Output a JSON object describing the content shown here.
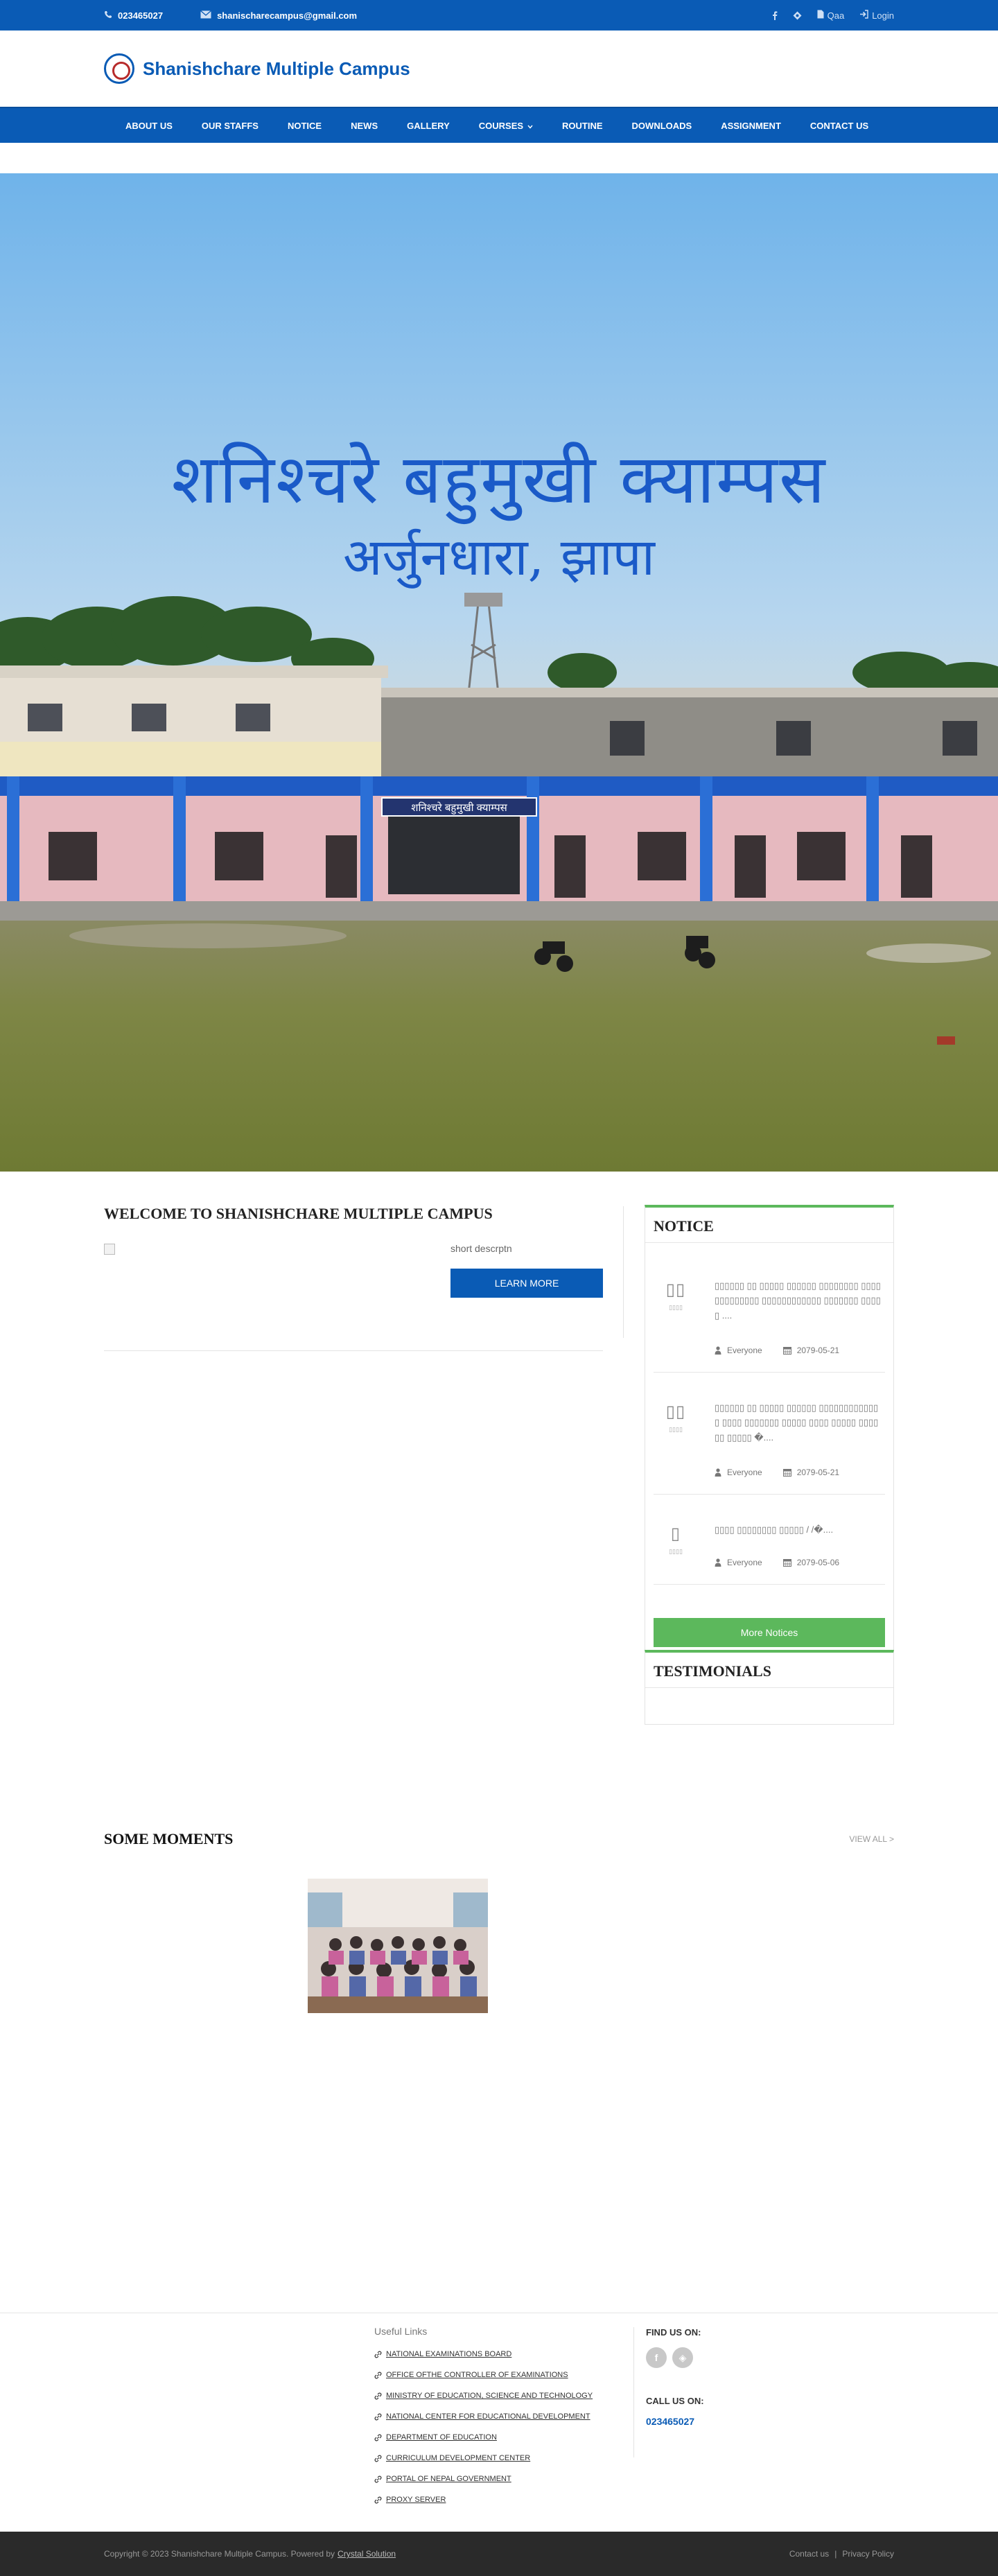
{
  "topbar": {
    "phone": "023465027",
    "email": "shanischarecampus@gmail.com",
    "qaa": "Qaa",
    "login": "Login"
  },
  "header": {
    "title": "Shanishchare Multiple Campus"
  },
  "nav": {
    "items": [
      "ABOUT US",
      "OUR STAFFS",
      "NOTICE",
      "NEWS",
      "GALLERY",
      "COURSES",
      "ROUTINE",
      "DOWNLOADS",
      "ASSIGNMENT",
      "CONTACT US"
    ]
  },
  "hero": {
    "line1": "शनिश्चरे बहुमुखी क्याम्पस",
    "line2": "अर्जुनधारा, झापा",
    "sign": "शनिश्चरे बहुमुखी क्याम्पस"
  },
  "welcome": {
    "heading": "WELCOME TO SHANISHCHARE MULTIPLE CAMPUS",
    "short_description": "short descrptn",
    "learn_more": "LEARN MORE"
  },
  "notice": {
    "heading": "NOTICE",
    "items": [
      {
        "day": "▯▯",
        "month": "▯▯▯▯",
        "title": "▯▯▯▯▯▯ ▯▯ ▯▯▯▯▯ ▯▯▯▯▯▯ ▯▯▯▯▯▯▯▯ ▯▯▯▯▯▯▯▯▯▯▯▯▯ ▯▯▯▯▯▯▯▯▯▯▯▯ ▯▯▯▯▯▯▯ ▯▯▯▯▯ ....",
        "audience": "Everyone",
        "date": "2079-05-21"
      },
      {
        "day": "▯▯",
        "month": "▯▯▯▯",
        "title": "▯▯▯▯▯▯ ▯▯ ▯▯▯▯▯ ▯▯▯▯▯▯ ▯▯▯▯▯▯▯▯▯▯▯▯▯ ▯▯▯▯ ▯▯▯▯▯▯▯ ▯▯▯▯▯ ▯▯▯▯ ▯▯▯▯▯ ▯▯▯▯▯▯ ▯▯▯▯▯ �....",
        "audience": "Everyone",
        "date": "2079-05-21"
      },
      {
        "day": "▯",
        "month": "▯▯▯▯",
        "title": "▯▯▯▯ ▯▯▯▯▯▯▯▯ ▯▯▯▯▯ / /�....",
        "audience": "Everyone",
        "date": "2079-05-06"
      }
    ],
    "more": "More Notices"
  },
  "testimonials": {
    "heading": "TESTIMONIALS"
  },
  "moments": {
    "heading": "SOME MOMENTS",
    "view_all": "VIEW ALL >"
  },
  "footer": {
    "useful_links_heading": "Useful Links",
    "links": [
      "NATIONAL EXAMINATIONS BOARD",
      "OFFICE OFTHE CONTROLLER OF EXAMINATIONS",
      "MINISTRY OF EDUCATION, SCIENCE AND TECHNOLOGY",
      "NATIONAL CENTER FOR EDUCATIONAL DEVELOPMENT",
      "DEPARTMENT OF EDUCATION",
      "CURRICULUM DEVELOPMENT CENTER",
      "PORTAL OF NEPAL GOVERNMENT",
      "PROXY SERVER"
    ],
    "find_us": "FIND US ON:",
    "call_us": "CALL US ON:",
    "phone": "023465027"
  },
  "copyright": {
    "text": "Copyright © 2023 Shanishchare Multiple Campus. Powered by",
    "powered": "Crystal Solution",
    "contact": "Contact us",
    "privacy": "Privacy Policy"
  },
  "colors": {
    "brand": "#0a5bb5",
    "accent_green": "#5cb85c"
  }
}
